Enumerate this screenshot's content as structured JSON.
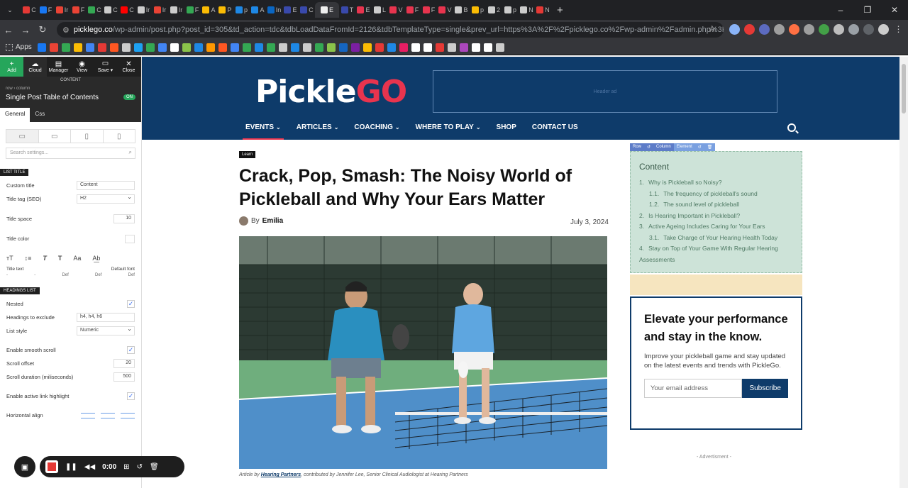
{
  "browser": {
    "tab_icons": [
      {
        "icon": "youtube-icon",
        "color": "#e53935"
      },
      {
        "icon": "facebook-icon",
        "color": "#1877f2"
      },
      {
        "icon": "gmail-icon",
        "color": "#ea4335"
      },
      {
        "icon": "gmail-icon",
        "color": "#ea4335"
      },
      {
        "icon": "chrome-icon",
        "color": "#34a853"
      },
      {
        "icon": "car-icon",
        "color": "#cccccc"
      },
      {
        "icon": "youtube-icon",
        "color": "#ff0000"
      },
      {
        "icon": "web-icon",
        "color": "#cccccc"
      },
      {
        "icon": "gmail-icon",
        "color": "#ea4335"
      },
      {
        "icon": "web-icon",
        "color": "#cccccc"
      },
      {
        "icon": "chatgpt-icon",
        "color": "#34a853"
      },
      {
        "icon": "drive-icon",
        "color": "#fbbc04"
      },
      {
        "icon": "drive-icon",
        "color": "#fbbc04"
      },
      {
        "icon": "pinterest-icon",
        "color": "#1e88e5"
      },
      {
        "icon": "pinterest-icon",
        "color": "#1e88e5"
      },
      {
        "icon": "linkedin-icon",
        "color": "#0a66c2"
      },
      {
        "icon": "site-icon",
        "color": "#3949ab"
      },
      {
        "icon": "site-icon",
        "color": "#3949ab"
      },
      {
        "icon": "site-icon",
        "color": "#eeeeee"
      },
      {
        "icon": "site-icon",
        "color": "#3949ab"
      },
      {
        "icon": "pickle-icon",
        "color": "#e8344e"
      },
      {
        "icon": "car-icon",
        "color": "#cccccc"
      },
      {
        "icon": "pickle-icon",
        "color": "#e8344e"
      },
      {
        "icon": "pickle-icon",
        "color": "#e8344e"
      },
      {
        "icon": "pickle-icon",
        "color": "#e8344e"
      },
      {
        "icon": "pickle-icon",
        "color": "#e8344e"
      },
      {
        "icon": "google-icon",
        "color": "#cccccc"
      },
      {
        "icon": "note-icon",
        "color": "#fbbc04"
      },
      {
        "icon": "google-icon",
        "color": "#cccccc"
      },
      {
        "icon": "notion-icon",
        "color": "#cccccc"
      },
      {
        "icon": "notion-icon",
        "color": "#cccccc"
      }
    ],
    "tab_labels": [
      "C",
      "F",
      "Ir",
      "F",
      "C",
      "C",
      "C",
      "Ir",
      "Ir",
      "Ir",
      "F",
      "A",
      "P",
      "p",
      "A",
      "In",
      "E",
      "C",
      "E",
      "T",
      "E",
      "L",
      "V",
      "F",
      "F",
      "V",
      "B",
      "p",
      "2",
      "p",
      "N",
      "N"
    ],
    "active_tab_label": "E",
    "new_tab": "+",
    "window_controls": {
      "minimize": "–",
      "maximize": "❐",
      "close": "✕"
    },
    "url_host": "picklego.co",
    "url_path": "/wp-admin/post.php?post_id=305&td_action=tdc&tdbLoadDataFromId=2126&tdbTemplateType=single&prev_url=https%3A%2F%2Fpicklego.co%2Fwp-admin%2Fadmin.php%3Fpage%3Dtdb_cloud_te...",
    "bookmarks_apps_label": "Apps",
    "bookmark_colors": [
      "#1877f2",
      "#ea4335",
      "#34a853",
      "#fbbc04",
      "#4285f4",
      "#e53935",
      "#ff5722",
      "#cccccc",
      "#1da1f2",
      "#34a853",
      "#4285f4",
      "#ffffff",
      "#8bc34a",
      "#1e88e5",
      "#ff9800",
      "#ff5722",
      "#4285f4",
      "#34a853",
      "#1e88e5",
      "#34a853",
      "#cccccc",
      "#1e88e5",
      "#cccccc",
      "#34a853",
      "#8bc34a",
      "#1565c0",
      "#7b1fa2",
      "#fbbc04",
      "#e53935",
      "#1e88e5",
      "#e91e63",
      "#ffffff",
      "#ffffff",
      "#e53935",
      "#cccccc",
      "#ab47bc",
      "#ffffff",
      "#ffffff",
      "#cccccc"
    ]
  },
  "editor": {
    "toolbar": [
      {
        "icon": "plus-icon",
        "label": "Add"
      },
      {
        "icon": "cloud-icon",
        "label": "Cloud"
      },
      {
        "icon": "layers-icon",
        "label": "Manager"
      },
      {
        "icon": "eye-icon",
        "label": "View"
      },
      {
        "icon": "save-icon",
        "label": "Save ▾"
      },
      {
        "icon": "close-icon",
        "label": "Close"
      }
    ],
    "panel_label": "CONTENT",
    "breadcrumb": "row › column",
    "element_title": "Single Post Table of Contents",
    "toggle_label": "ON",
    "tabs": [
      "General",
      "Css"
    ],
    "search_placeholder": "Search settings...",
    "section_list_title": "LIST TITLE",
    "custom_title_label": "Custom title",
    "custom_title_value": "Content",
    "title_tag_label": "Title tag (SEO)",
    "title_tag_value": "H2",
    "title_space_label": "Title space",
    "title_space_value": "10",
    "title_color_label": "Title color",
    "title_text_label": "Title text",
    "title_text_value": "Default font",
    "typo_defaults": [
      "-",
      "-",
      "Def",
      "Def",
      "Def"
    ],
    "section_headings_list": "HEADINGS LIST",
    "nested_label": "Nested",
    "headings_exclude_label": "Headings to exclude",
    "headings_exclude_value": "h4, h4, h6",
    "list_style_label": "List style",
    "list_style_value": "Numeric",
    "smooth_scroll_label": "Enable smooth scroll",
    "scroll_offset_label": "Scroll offset",
    "scroll_offset_value": "20",
    "scroll_duration_label": "Scroll duration (miliseconds)",
    "scroll_duration_value": "500",
    "active_link_label": "Enable active link highlight",
    "horizontal_align_label": "Horizontal align",
    "checkmark": "✓"
  },
  "recorder": {
    "time": "0:00"
  },
  "site": {
    "logo_part1": "Pickle",
    "logo_part2": "GO",
    "header_ad": "Header ad",
    "menu": [
      {
        "label": "EVENTS",
        "dropdown": true,
        "active": true
      },
      {
        "label": "ARTICLES",
        "dropdown": true,
        "active": false
      },
      {
        "label": "COACHING",
        "dropdown": true,
        "active": false
      },
      {
        "label": "WHERE TO PLAY",
        "dropdown": true,
        "active": false
      },
      {
        "label": "SHOP",
        "dropdown": false,
        "active": false
      },
      {
        "label": "CONTACT US",
        "dropdown": false,
        "active": false
      }
    ],
    "category_tag": "Learn",
    "post_title": "Crack, Pop, Smash: The Noisy World of Pickleball and Why Your Ears Matter",
    "by_label": "By",
    "author": "Emilia",
    "date": "July 3, 2024",
    "caption_prefix": "Article by",
    "caption_link": "Hearing Partners",
    "caption_suffix": ", contributed by Jennifer Lee, Senior Clinical Audiologist at Hearing Partners",
    "toc_controls": [
      "Row",
      "↺",
      "Column",
      "Element",
      "↺",
      "🗑"
    ],
    "toc_heading": "Content",
    "toc_items": [
      {
        "num": "1.",
        "text": "Why is Pickleball so Noisy?",
        "sub": false
      },
      {
        "num": "1.1.",
        "text": "The frequency of pickleball's sound",
        "sub": true
      },
      {
        "num": "1.2.",
        "text": "The sound level of pickleball",
        "sub": true
      },
      {
        "num": "2.",
        "text": "Is Hearing Important in Pickleball?",
        "sub": false
      },
      {
        "num": "3.",
        "text": "Active Ageing Includes Caring for Your Ears",
        "sub": false
      },
      {
        "num": "3.1.",
        "text": "Take Charge of Your Hearing Health Today",
        "sub": true
      },
      {
        "num": "4.",
        "text": "Stay on Top of Your Game With Regular Hearing Assessments",
        "sub": false
      }
    ],
    "newsletter_title": "Elevate your performance and stay in the know.",
    "newsletter_text": "Improve your pickleball game and stay updated on the latest events and trends with PickleGo.",
    "email_placeholder": "Your email address",
    "subscribe_label": "Subscribe",
    "advertisment_label": "- Advertisment -"
  },
  "colors": {
    "brand_navy": "#0e3b6a",
    "brand_red": "#e8344e",
    "toc_bg": "#cde3d8",
    "editor_green": "#26a65b"
  }
}
